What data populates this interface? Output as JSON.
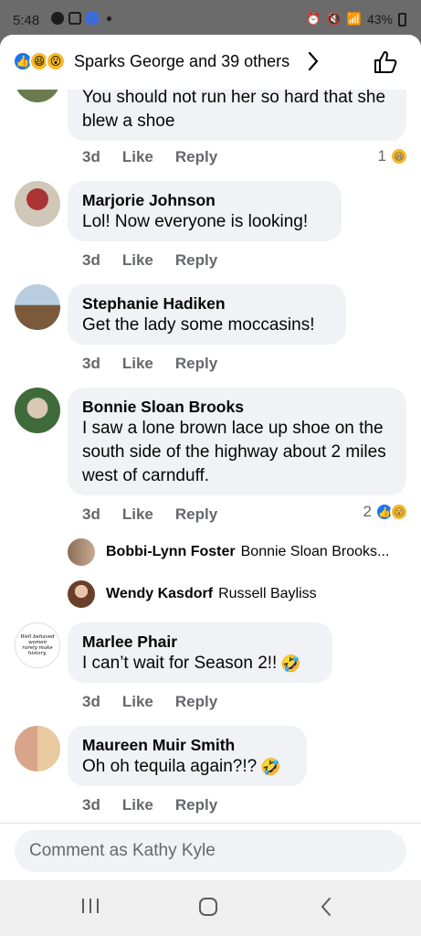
{
  "status_bar": {
    "time": "5:48",
    "battery": "43%"
  },
  "reactions_header": {
    "names": "Sparks George and 39 others"
  },
  "comments": [
    {
      "author": "",
      "text": "You should not run her so hard that she blew a shoe",
      "time": "3d",
      "like": "Like",
      "reply": "Reply",
      "reaction_count": "1"
    },
    {
      "author": "Marjorie Johnson",
      "text": "Lol!  Now everyone is looking!",
      "time": "3d",
      "like": "Like",
      "reply": "Reply"
    },
    {
      "author": "Stephanie Hadiken",
      "text": "Get the lady some moccasins!",
      "time": "3d",
      "like": "Like",
      "reply": "Reply"
    },
    {
      "author": "Bonnie Sloan Brooks",
      "text": "I saw a lone brown lace up shoe on the south side of the highway about 2 miles west of carnduff.",
      "time": "3d",
      "like": "Like",
      "reply": "Reply",
      "reaction_count": "2"
    },
    {
      "author": "Marlee Phair",
      "text": "I can’t wait for Season 2!!",
      "time": "3d",
      "like": "Like",
      "reply": "Reply"
    },
    {
      "author": "Maureen Muir Smith",
      "text": "Oh oh tequila again?!?",
      "time": "3d",
      "like": "Like",
      "reply": "Reply"
    }
  ],
  "replies": [
    {
      "author": "Bobbi-Lynn Foster",
      "text": "Bonnie Sloan Brooks..."
    },
    {
      "author": "Wendy Kasdorf",
      "text": "Russell Bayliss"
    }
  ],
  "avatar_text": "Well behaved women rarely make history.",
  "composer": {
    "placeholder": "Comment as Kathy Kyle"
  },
  "colors": {
    "bubble": "#f0f2f5",
    "like_blue": "#1877f2",
    "emoji_yellow": "#f7b928"
  }
}
